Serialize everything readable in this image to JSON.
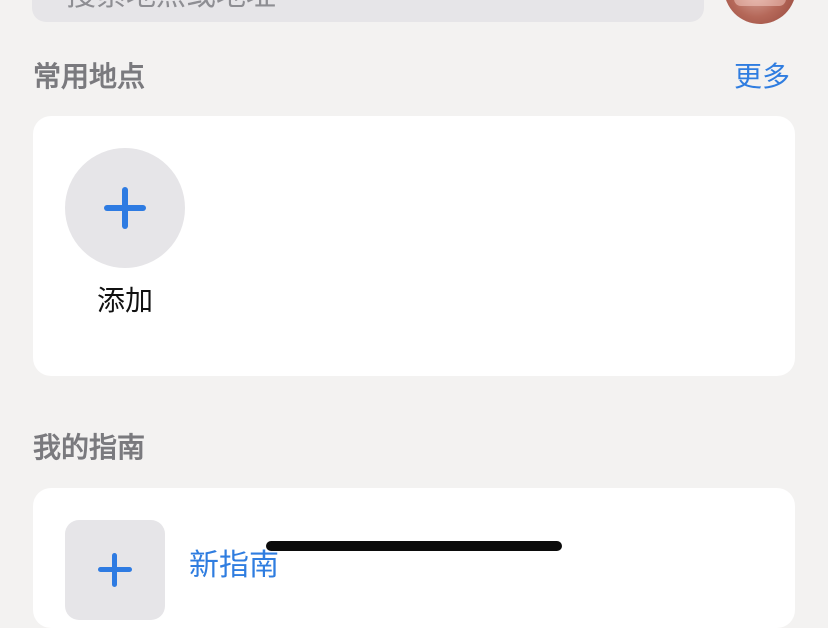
{
  "search": {
    "placeholder": "搜索地点或地址"
  },
  "favorites": {
    "title": "常用地点",
    "more_label": "更多",
    "add_label": "添加"
  },
  "guides": {
    "title": "我的指南",
    "new_guide_label": "新指南"
  },
  "colors": {
    "accent": "#2f7de0",
    "background": "#f3f2f1",
    "card": "#ffffff",
    "tile": "#e6e5e8"
  }
}
